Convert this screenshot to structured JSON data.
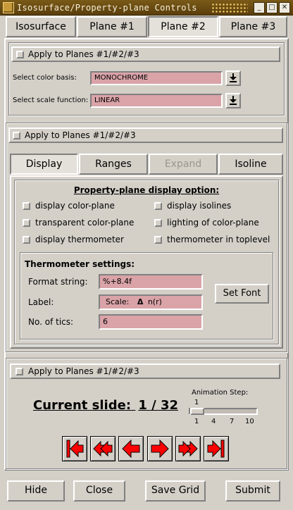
{
  "window": {
    "title": "Isosurface/Property-plane Controls",
    "buttons": {
      "minimize": "_",
      "maximize": "□",
      "close": "✕"
    }
  },
  "top_tabs": [
    {
      "label": "Isosurface",
      "selected": false
    },
    {
      "label": "Plane #1",
      "selected": false
    },
    {
      "label": "Plane #2",
      "selected": true
    },
    {
      "label": "Plane #3",
      "selected": false
    }
  ],
  "color_section": {
    "apply_label": "Apply to Planes #1/#2/#3",
    "color_basis_label": "Select color basis:",
    "color_basis_value": "MONOCHROME",
    "scale_function_label": "Select scale function:",
    "scale_function_value": "LINEAR",
    "dropdown_icon": "arrow-down-to-bar-icon"
  },
  "display_section": {
    "apply_label": "Apply to Planes #1/#2/#3",
    "tabs": [
      {
        "label": "Display",
        "selected": true,
        "disabled": false
      },
      {
        "label": "Ranges",
        "selected": false,
        "disabled": false
      },
      {
        "label": "Expand",
        "selected": false,
        "disabled": true
      },
      {
        "label": "Isoline",
        "selected": false,
        "disabled": false
      }
    ],
    "option_heading": "Property-plane display option:",
    "options": [
      {
        "label": "display color-plane",
        "checked": false
      },
      {
        "label": "display isolines",
        "checked": false
      },
      {
        "label": "transparent color-plane",
        "checked": false
      },
      {
        "label": "lighting of color-plane",
        "checked": false
      },
      {
        "label": "display thermometer",
        "checked": false
      },
      {
        "label": "thermometer in toplevel",
        "checked": false
      }
    ],
    "thermometer": {
      "heading": "Thermometer settings:",
      "format_label": "Format string:",
      "format_value": "%+8.4f",
      "label_label": "Label:",
      "label_value_prefix": "Scale:",
      "label_value_symbol": "Δ",
      "label_value_suffix": "n(r)",
      "tics_label": "No. of tics:",
      "tics_value": "6",
      "set_font_label": "Set Font"
    }
  },
  "animation_section": {
    "apply_label": "Apply to Planes #1/#2/#3",
    "current_slide_label": "Current slide:",
    "current_slide_value": "1 / 32",
    "step_label": "Animation Step:",
    "step_value": "1",
    "step_min": 1,
    "step_max": 10,
    "step_ticks": [
      "1",
      "4",
      "7",
      "10"
    ],
    "nav_icons": [
      "first-slide-icon",
      "rewind-icon",
      "previous-slide-icon",
      "next-slide-icon",
      "fast-forward-icon",
      "last-slide-icon"
    ],
    "nav_color": "#ff0000"
  },
  "footer": {
    "hide_label": "Hide",
    "close_label": "Close",
    "save_grid_label": "Save Grid",
    "submit_label": "Submit"
  },
  "colors": {
    "field_bg": "#d9a3a8",
    "panel_bg": "#d4d0c8",
    "titlebar": "#6a4c12"
  }
}
